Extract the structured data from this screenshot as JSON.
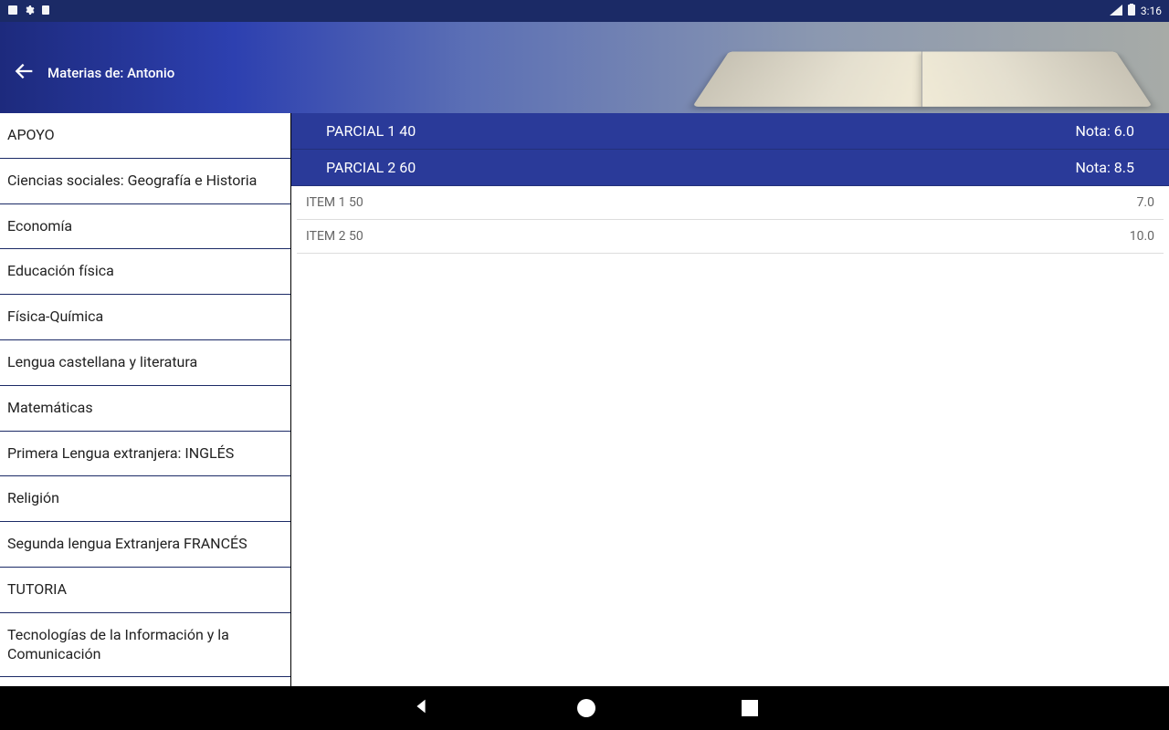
{
  "status": {
    "time": "3:16",
    "icons_left": [
      "square-icon",
      "gear-icon",
      "clipboard-icon"
    ],
    "icons_right": [
      "signal-icon",
      "battery-icon"
    ]
  },
  "header": {
    "title": "Materias de:  Antonio"
  },
  "sidebar": {
    "items": [
      {
        "label": "APOYO"
      },
      {
        "label": "Ciencias sociales: Geografía e Historia"
      },
      {
        "label": "Economía"
      },
      {
        "label": "Educación física"
      },
      {
        "label": "Física-Química"
      },
      {
        "label": "Lengua castellana y literatura"
      },
      {
        "label": "Matemáticas"
      },
      {
        "label": "Primera Lengua extranjera: INGLÉS"
      },
      {
        "label": "Religión"
      },
      {
        "label": "Segunda lengua Extranjera FRANCÉS"
      },
      {
        "label": "TUTORIA"
      },
      {
        "label": "Tecnologías de la Información y la Comunicación"
      }
    ]
  },
  "main": {
    "parcial1": {
      "label": "PARCIAL 1 40",
      "nota": "Nota: 6.0"
    },
    "parcial2": {
      "label": "PARCIAL 2 60",
      "nota": "Nota: 8.5"
    },
    "items": [
      {
        "label": "ITEM 1 50",
        "value": "7.0"
      },
      {
        "label": "ITEM 2 50",
        "value": "10.0"
      }
    ]
  }
}
